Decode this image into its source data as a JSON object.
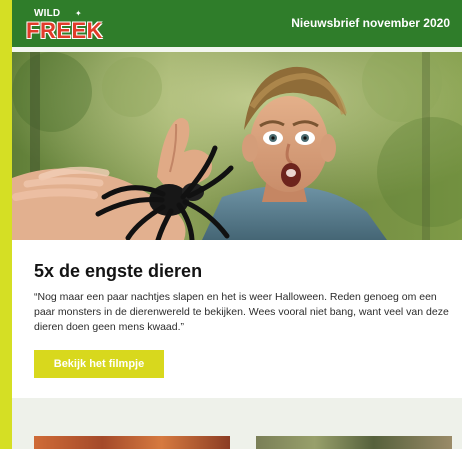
{
  "header": {
    "logo_top": "WILD",
    "logo_main": "FREEK",
    "newsletter_label": "Nieuwsbrief november 2020"
  },
  "article": {
    "title": "5x de engste dieren",
    "body": "“Nog maar een paar nachtjes slapen en het is weer Halloween. Reden genoeg om een paar monsters in de dierenwereld te bekijken. Wees vooral niet bang, want veel van deze dieren doen geen mens kwaad.”",
    "button_label": "Bekijk het filmpje"
  },
  "colors": {
    "frame": "#d5df24",
    "header_green": "#2f7d2a",
    "logo_red": "#e13c2a",
    "button_yellow": "#d8d81d"
  }
}
